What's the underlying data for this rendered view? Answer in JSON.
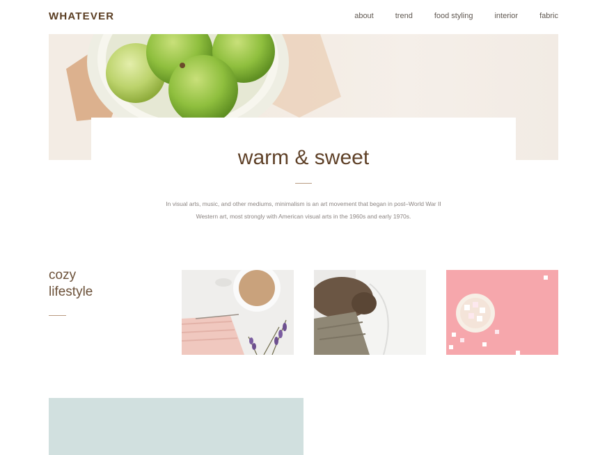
{
  "header": {
    "logo": "WHATEVER",
    "nav": [
      "about",
      "trend",
      "food styling",
      "interior",
      "fabric"
    ]
  },
  "intro": {
    "title": "warm & sweet",
    "description_line1": "In visual arts, music, and other mediums, minimalism is an art movement that began in post–World War II",
    "description_line2": "Western art, most strongly with American visual arts in the 1960s and early 1970s."
  },
  "section": {
    "title_line1": "cozy",
    "title_line2": "lifestyle"
  },
  "colors": {
    "accent": "#5a3d22",
    "rule": "#b89a80",
    "pink": "#f6a7ac",
    "mint": "#d1e0df"
  }
}
